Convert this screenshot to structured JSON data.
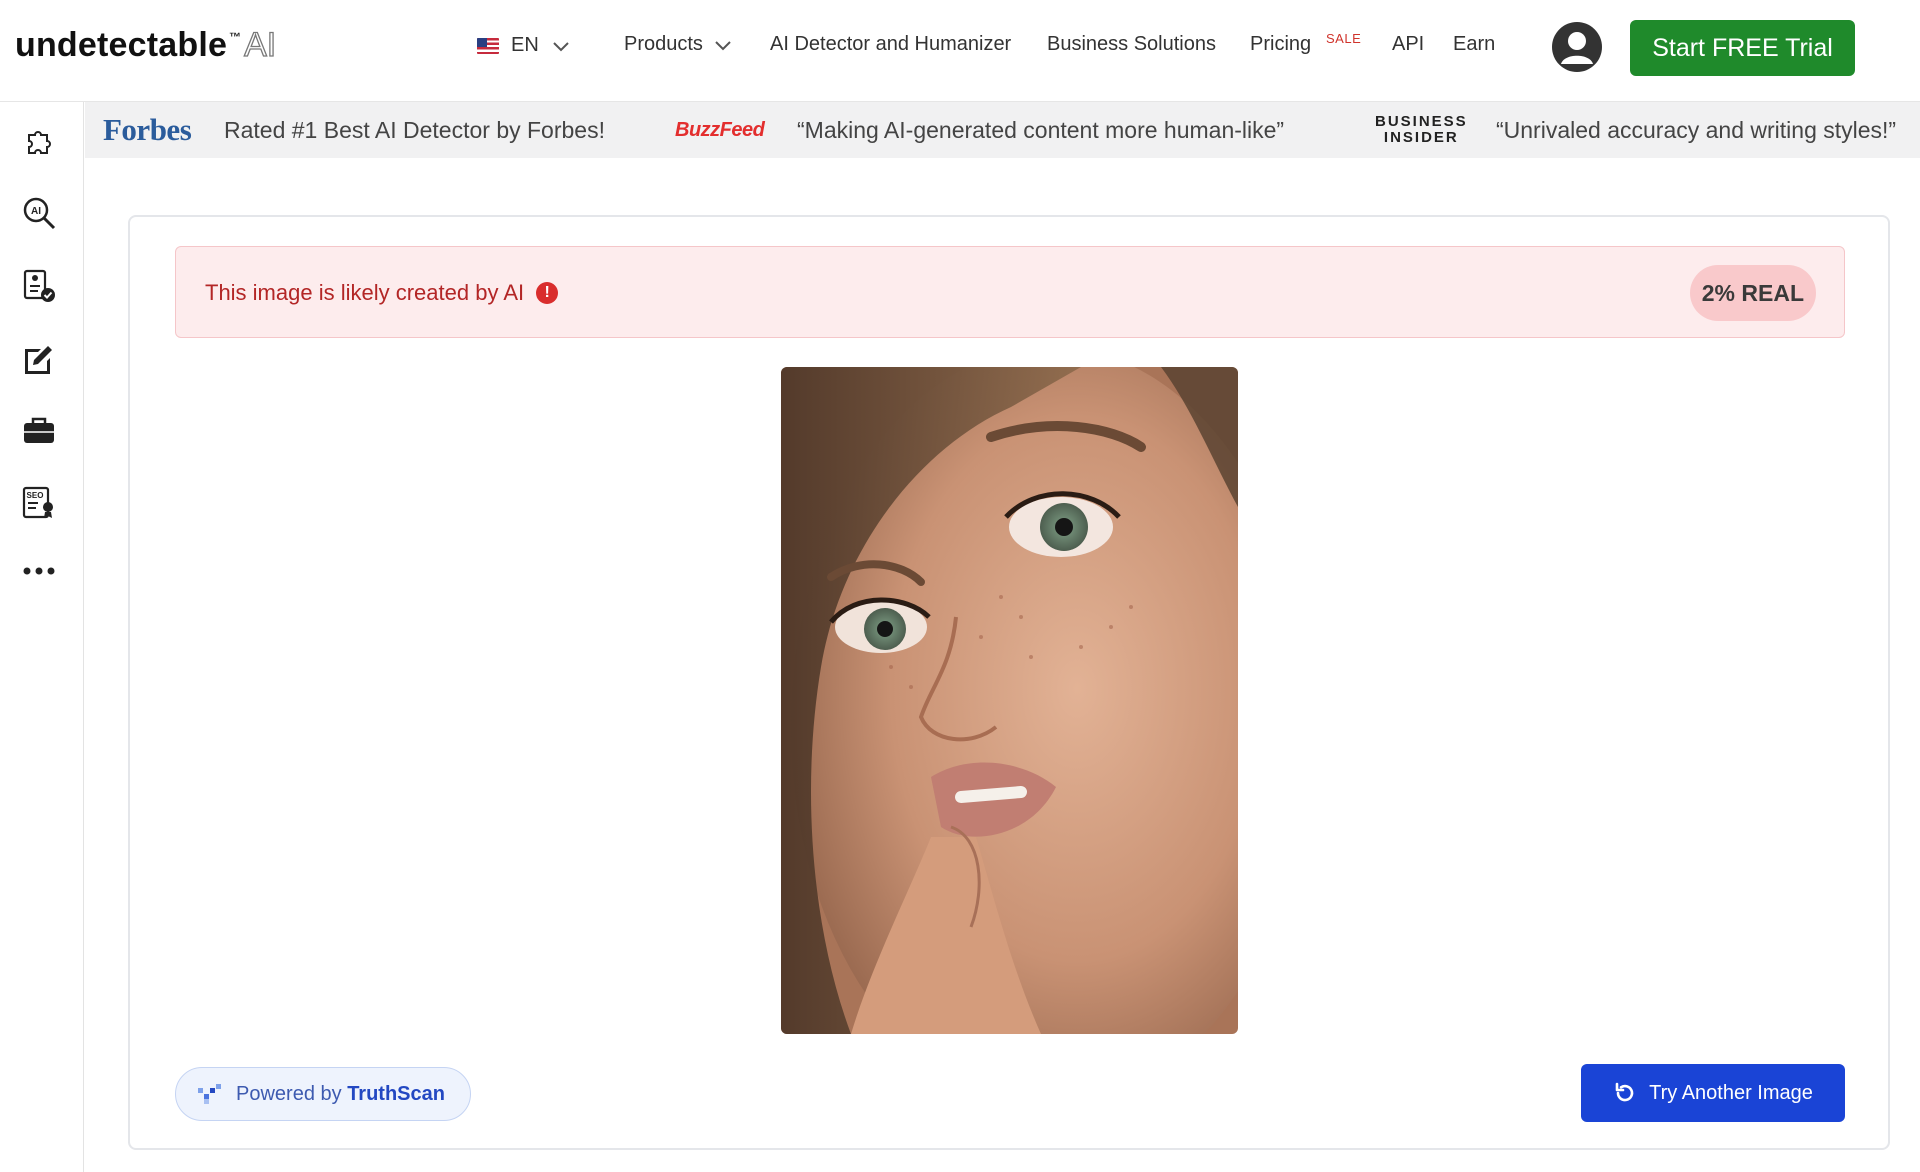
{
  "header": {
    "logo_main": "undetectable",
    "logo_tm": "™",
    "logo_ai": "AI",
    "language": {
      "flag_icon": "us-flag-icon",
      "code": "EN"
    },
    "nav": {
      "products": "Products",
      "detector": "AI Detector and Humanizer",
      "business": "Business Solutions",
      "pricing": "Pricing",
      "sale": "SALE",
      "api": "API",
      "earn": "Earn"
    },
    "cta": "Start FREE Trial",
    "colors": {
      "cta": "#1f8a2b"
    }
  },
  "sidebar": {
    "icons": [
      "puzzle-icon",
      "ai-search-icon",
      "document-check-icon",
      "edit-icon",
      "briefcase-icon",
      "seo-report-icon",
      "more-icon"
    ]
  },
  "press": {
    "forbes_logo": "Forbes",
    "forbes_quote": "Rated #1 Best AI Detector by Forbes!",
    "buzzfeed_logo": "BuzzFeed",
    "buzzfeed_quote": "“Making AI-generated content more human-like”",
    "bi_logo_line1": "BUSINESS",
    "bi_logo_line2": "INSIDER",
    "bi_quote": "“Unrivaled accuracy and writing styles!”"
  },
  "result": {
    "message": "This image is likely created by AI",
    "badge": "2% REAL",
    "real_percent": 2,
    "colors": {
      "alert_text": "#b32626",
      "alert_bg": "#fdeced"
    }
  },
  "footer": {
    "powered_prefix": "Powered by",
    "powered_brand": "TruthScan",
    "try_another": "Try Another Image",
    "colors": {
      "try_button": "#1a44d6"
    }
  }
}
